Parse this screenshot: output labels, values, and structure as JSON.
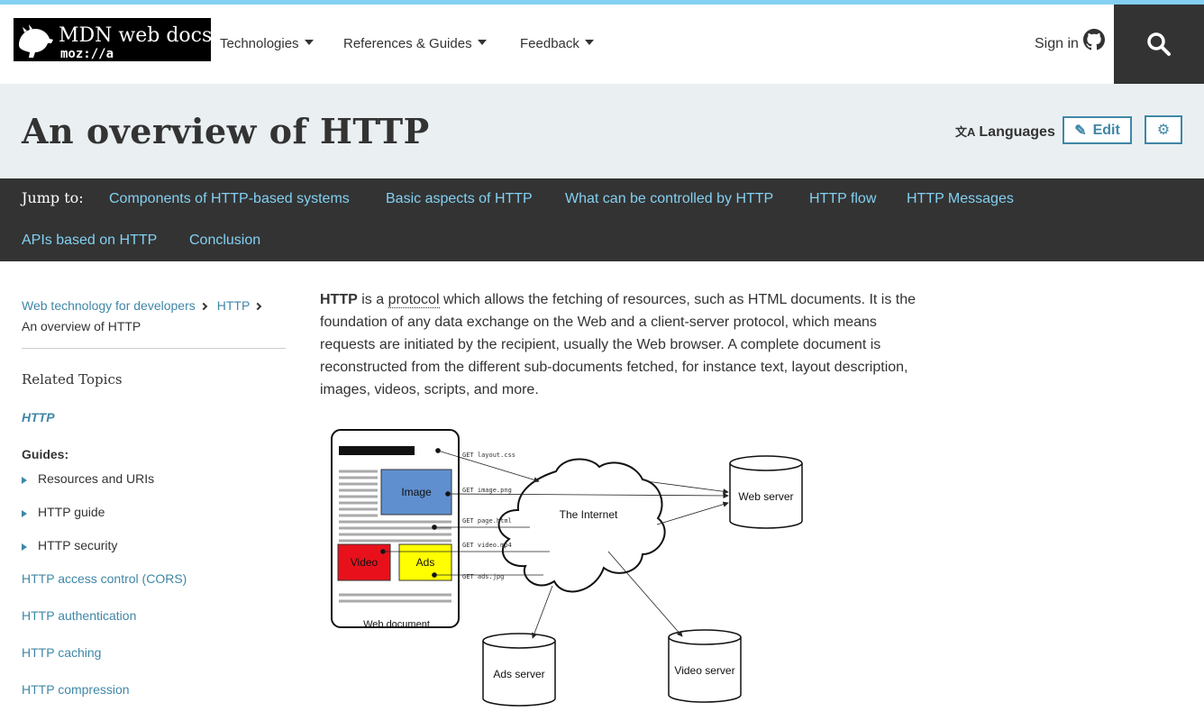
{
  "header": {
    "logo": {
      "title": "MDN web docs",
      "subtitle": "moz://a"
    },
    "nav": [
      {
        "label": "Technologies"
      },
      {
        "label": "References & Guides"
      },
      {
        "label": "Feedback"
      }
    ],
    "sign_in": "Sign in"
  },
  "title_bar": {
    "title": "An overview of HTTP",
    "languages": "Languages",
    "edit": "Edit"
  },
  "jump": {
    "label": "Jump to:",
    "links": [
      "Components of HTTP-based systems",
      "Basic aspects of HTTP",
      "What can be controlled by HTTP",
      "HTTP flow",
      "HTTP Messages",
      "APIs based on HTTP",
      "Conclusion"
    ]
  },
  "breadcrumbs": {
    "items": [
      "Web technology for developers",
      "HTTP"
    ],
    "current": "An overview of HTTP"
  },
  "sidebar": {
    "related_title": "Related Topics",
    "http": "HTTP",
    "guides_label": "Guides:",
    "guides": [
      "Resources and URIs",
      "HTTP guide",
      "HTTP security"
    ],
    "links": [
      "HTTP access control (CORS)",
      "HTTP authentication",
      "HTTP caching",
      "HTTP compression"
    ]
  },
  "content": {
    "intro_term": "HTTP",
    "intro_is": " is a ",
    "intro_link": "protocol",
    "intro_rest": " which allows the fetching of resources, such as HTML documents. It is the foundation of any data exchange on the Web and a client-server protocol, which means requests are initiated by the recipient, usually the Web browser. A complete document is reconstructed from the different sub-documents fetched, for instance text, layout description, images, videos, scripts, and more."
  },
  "diagram": {
    "image_label": "Image",
    "video_label": "Video",
    "ads_label": "Ads",
    "doc_label": "Web document",
    "internet_label": "The Internet",
    "web_server": "Web server",
    "ads_server": "Ads server",
    "video_server": "Video server",
    "requests": [
      "GET layout.css",
      "GET image.png",
      "GET page.html",
      "GET video.mp4",
      "GET ads.jpg"
    ]
  },
  "colors": {
    "accent": "#3f87a6",
    "jump_link": "#83d0f2",
    "image_box": "#5f8fcf",
    "video_box": "#e8111b",
    "ads_box": "#ffff00"
  }
}
